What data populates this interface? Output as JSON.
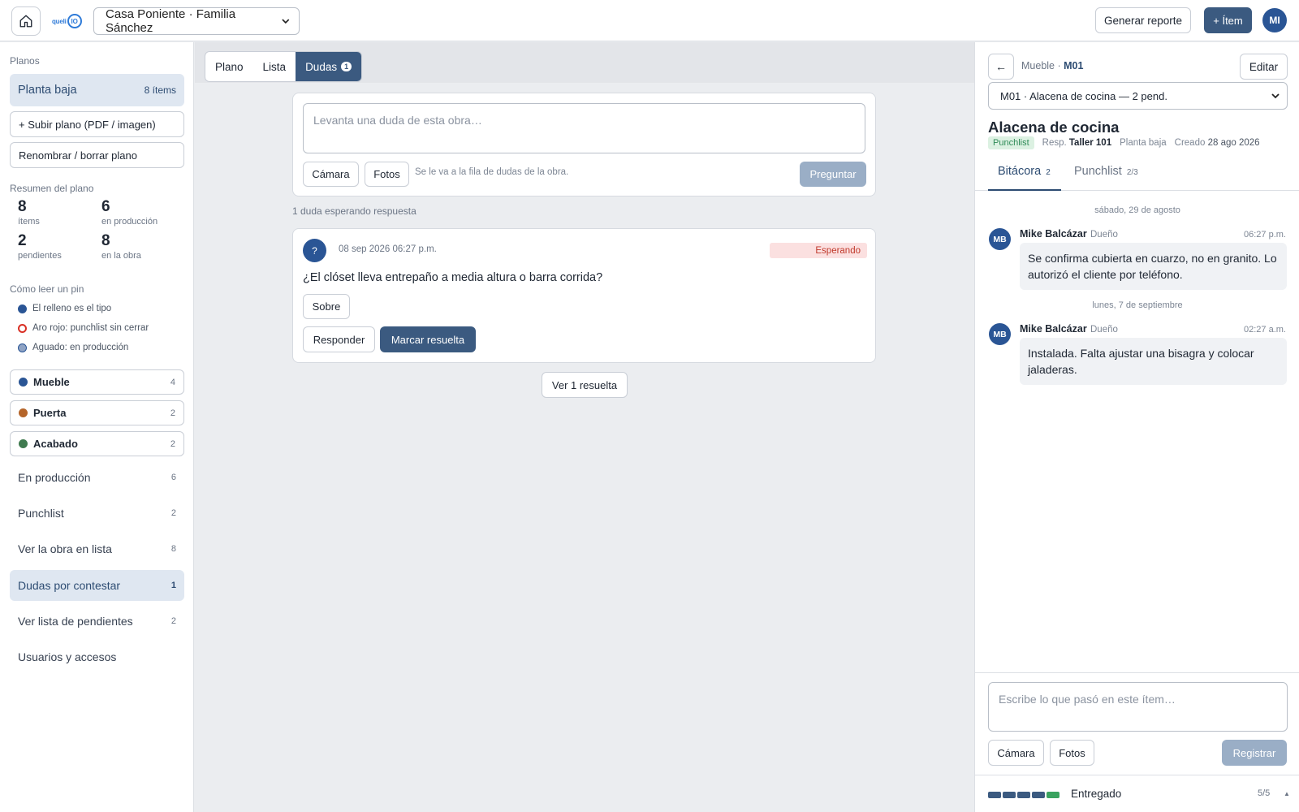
{
  "topbar": {
    "logo_word": "queli",
    "logo_mark": "IO",
    "project": "Casa Poniente · Familia Sánchez",
    "report_label": "Generar reporte",
    "add_item_label": "+ Ítem",
    "user_initials": "MI"
  },
  "sidebar": {
    "plans_label": "Planos",
    "active_plan": {
      "name": "Planta baja",
      "count": "8 ítems"
    },
    "upload_label": "+ Subir plano (PDF / imagen)",
    "rename_label": "Renombrar / borrar plano",
    "summary_label": "Resumen del plano",
    "stats": [
      {
        "value": "8",
        "label": "ítems"
      },
      {
        "value": "6",
        "label": "en producción"
      },
      {
        "value": "2",
        "label": "pendientes"
      },
      {
        "value": "8",
        "label": "en la obra"
      }
    ],
    "pin_help_label": "Cómo leer un pin",
    "pin_legend": [
      {
        "label": "El relleno es el tipo"
      },
      {
        "label": "Aro rojo: punchlist sin cerrar"
      },
      {
        "label": "Aguado: en producción"
      }
    ],
    "categories": [
      {
        "name": "Mueble",
        "count": "4",
        "color": "#2a5595"
      },
      {
        "name": "Puerta",
        "count": "2",
        "color": "#b5652a"
      },
      {
        "name": "Acabado",
        "count": "2",
        "color": "#3f7a4f"
      }
    ],
    "nav": [
      {
        "name": "En producción",
        "count": "6"
      },
      {
        "name": "Punchlist",
        "count": "2"
      },
      {
        "name": "Ver la obra en lista",
        "count": "8"
      },
      {
        "name": "Dudas por contestar",
        "count": "1"
      },
      {
        "name": "Ver lista de pendientes",
        "count": "2"
      },
      {
        "name": "Usuarios y accesos",
        "count": ""
      }
    ]
  },
  "center": {
    "tabs": [
      {
        "label": "Plano"
      },
      {
        "label": "Lista"
      },
      {
        "label": "Dudas",
        "badge": "1"
      }
    ],
    "ask": {
      "placeholder": "Levanta una duda de esta obra…",
      "camera_label": "Cámara",
      "photos_label": "Fotos",
      "hint": "Se le va a la fila de dudas de la obra.",
      "submit_label": "Preguntar"
    },
    "waiting_label": "1 duda esperando respuesta",
    "question": {
      "avatar": "?",
      "date": "08 sep 2026 06:27 p.m.",
      "status": "Esperando",
      "text": "¿El clóset lleva entrepaño a media altura o barra corrida?",
      "tag": "Sobre",
      "reply_label": "Responder",
      "resolve_label": "Marcar resuelta"
    },
    "resolved_label": "Ver 1 resuelta"
  },
  "panel": {
    "back_icon": "←",
    "crumb_prefix": "Mueble ·",
    "crumb_code": "M01",
    "edit_label": "Editar",
    "item_select": "M01 · Alacena de cocina — 2 pend.",
    "title": "Alacena de cocina",
    "status_pill": "Punchlist",
    "resp_label": "Resp.",
    "resp_value": "Taller 101",
    "plan": "Planta baja",
    "created_label": "Creado",
    "created_value": "28 ago 2026",
    "tabs": [
      {
        "label": "Bitácora",
        "count": "2"
      },
      {
        "label": "Punchlist",
        "count": "2/3"
      }
    ],
    "log": [
      {
        "day": "sábado, 29 de agosto",
        "initials": "MB",
        "author": "Mike Balcázar",
        "role": "Dueño",
        "time": "06:27 p.m.",
        "text": "Se confirma cubierta en cuarzo, no en granito. Lo autorizó el cliente por teléfono."
      },
      {
        "day": "lunes, 7 de septiembre",
        "initials": "MB",
        "author": "Mike Balcázar",
        "role": "Dueño",
        "time": "02:27 a.m.",
        "text": "Instalada. Falta ajustar una bisagra y colocar jaladeras."
      }
    ],
    "compose": {
      "placeholder": "Escribe lo que pasó en este ítem…",
      "camera_label": "Cámara",
      "photos_label": "Fotos",
      "submit_label": "Registrar"
    },
    "progress": {
      "label": "Entregado",
      "count": "5/5",
      "steps_done": 5,
      "steps_total": 5,
      "step_color": "#3b5a80",
      "final_color": "#3aa35f"
    }
  }
}
